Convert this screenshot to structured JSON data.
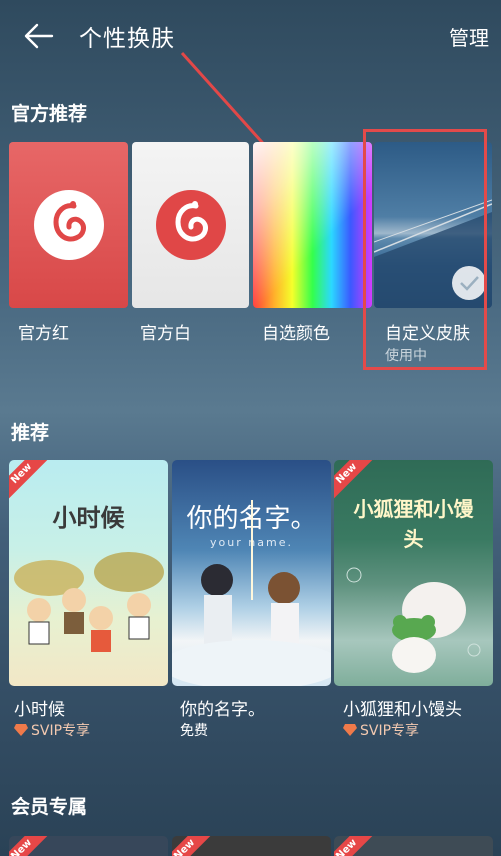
{
  "header": {
    "title": "个性换肤",
    "manage": "管理"
  },
  "official": {
    "title": "官方推荐",
    "items": [
      {
        "label": "官方红"
      },
      {
        "label": "官方白"
      },
      {
        "label": "自选颜色"
      },
      {
        "label": "自定义皮肤",
        "status": "使用中"
      }
    ]
  },
  "recommend": {
    "title": "推荐",
    "items": [
      {
        "art_title": "小时候",
        "name": "小时候",
        "tag": "New",
        "price": "SVIP专享"
      },
      {
        "art_title": "你的名字。",
        "art_subtitle": "your name.",
        "name": "你的名字。",
        "price": "免费"
      },
      {
        "art_title": "小狐狸和小馒头",
        "name": "小狐狸和小馒头",
        "tag": "New",
        "price": "SVIP专享"
      }
    ]
  },
  "member": {
    "title": "会员专属",
    "tags": [
      "New",
      "New",
      "New"
    ]
  },
  "colors": {
    "accent_red": "#e34a4a",
    "svip": "#f07a4a"
  }
}
